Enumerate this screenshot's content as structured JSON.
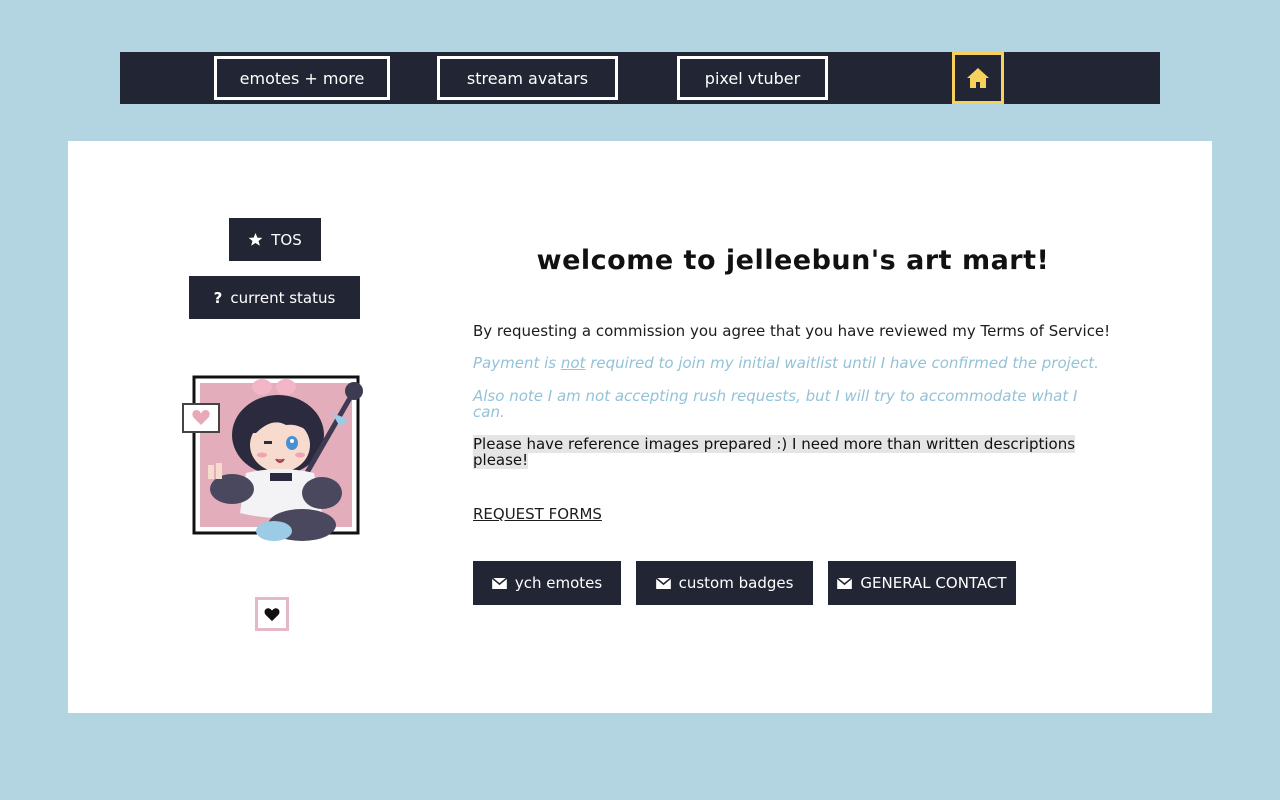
{
  "nav": {
    "items": [
      {
        "label": "emotes + more"
      },
      {
        "label": "stream avatars"
      },
      {
        "label": "pixel vtuber"
      }
    ],
    "home_icon": "home-icon",
    "accent": "#f6d25c"
  },
  "sidebar": {
    "tos_label": "TOS",
    "tos_icon": "star-icon",
    "status_label": "current status",
    "status_icon": "question-icon",
    "heart_icon": "heart-icon"
  },
  "main": {
    "title": "welcome to jelleebun's art mart!",
    "p1": "By requesting a commission you agree that you have reviewed my Terms of Service!",
    "p2_before": "Payment is ",
    "p2_emph": "not",
    "p2_after": " required to join my initial waitlist until I have confirmed the project.",
    "p3": "Also note I am not accepting rush requests, but I will try to accommodate what I can.",
    "p4": "Please have reference images prepared :) I need more than written descriptions please!",
    "request_forms": "REQUEST FORMS",
    "buttons": [
      {
        "label": "ych emotes",
        "icon": "envelope-icon"
      },
      {
        "label": "custom badges",
        "icon": "envelope-icon"
      },
      {
        "label": "GENERAL CONTACT",
        "icon": "envelope-icon"
      }
    ]
  },
  "colors": {
    "background": "#b3d5e2",
    "dark": "#222533",
    "italic_text": "#93c2d8",
    "heart_border": "#e6b8c6"
  }
}
